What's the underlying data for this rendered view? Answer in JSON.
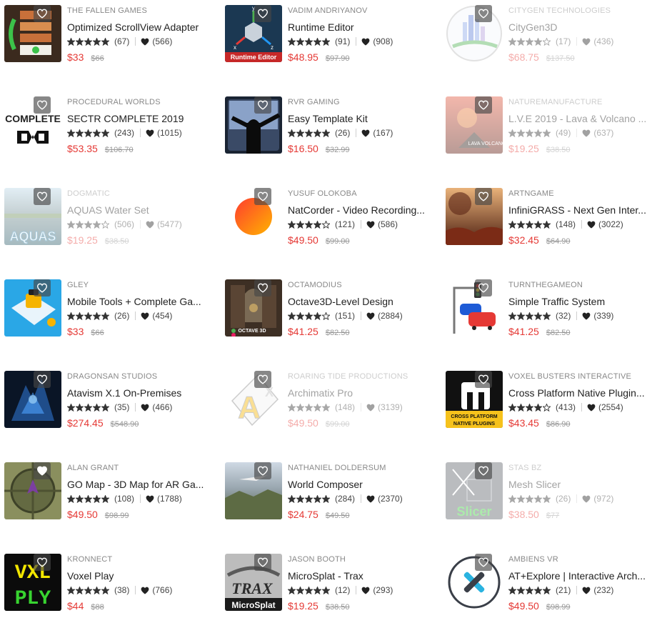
{
  "colors": {
    "price": "#e53935",
    "old_price": "#999999",
    "star": "#333333",
    "heart": "#222222"
  },
  "products": [
    {
      "publisher": "THE FALLEN GAMES",
      "title": "Optimized ScrollView Adapter",
      "rating": 5,
      "reviews": "(67)",
      "favorites": "(566)",
      "price": "$33",
      "old_price": "$66",
      "dimmed": false,
      "thumb": "scrollview-thumb",
      "fav_filled": false
    },
    {
      "publisher": "VADIM ANDRIYANOV",
      "title": "Runtime Editor",
      "rating": 5,
      "reviews": "(91)",
      "favorites": "(908)",
      "price": "$48.95",
      "old_price": "$97.90",
      "dimmed": false,
      "thumb": "runtime-editor-thumb",
      "thumb_text": "Runtime Editor",
      "axis_y": "y",
      "axis_x": "x",
      "axis_z": "z",
      "fav_filled": false
    },
    {
      "publisher": "CITYGEN TECHNOLOGIES",
      "title": "CityGen3D",
      "rating": 4,
      "reviews": "(17)",
      "favorites": "(436)",
      "price": "$68.75",
      "old_price": "$137.50",
      "dimmed": true,
      "thumb": "citygen-thumb",
      "fav_filled": false
    },
    {
      "publisher": "PROCEDURAL WORLDS",
      "title": "SECTR COMPLETE 2019",
      "rating": 5,
      "reviews": "(243)",
      "favorites": "(1015)",
      "price": "$53.35",
      "old_price": "$106.70",
      "dimmed": false,
      "thumb": "sectr-thumb",
      "thumb_text": "COMPLETE",
      "fav_filled": false
    },
    {
      "publisher": "RVR GAMING",
      "title": "Easy Template Kit",
      "rating": 5,
      "reviews": "(26)",
      "favorites": "(167)",
      "price": "$16.50",
      "old_price": "$32.99",
      "dimmed": false,
      "thumb": "template-kit-thumb",
      "fav_filled": false
    },
    {
      "publisher": "NATUREMANUFACTURE",
      "title": "L.V.E 2019 - Lava & Volcano ...",
      "rating": 5,
      "reviews": "(49)",
      "favorites": "(637)",
      "price": "$19.25",
      "old_price": "$38.50",
      "dimmed": true,
      "thumb": "lava-thumb",
      "thumb_text": "LAVA VOLCANO",
      "fav_filled": false
    },
    {
      "publisher": "DOGMATIC",
      "title": "AQUAS Water Set",
      "rating": 4,
      "reviews": "(506)",
      "favorites": "(5477)",
      "price": "$19.25",
      "old_price": "$38.50",
      "dimmed": true,
      "thumb": "aquas-thumb",
      "thumb_text": "AQUAS",
      "fav_filled": false
    },
    {
      "publisher": "YUSUF OLOKOBA",
      "title": "NatCorder - Video Recording...",
      "rating": 4,
      "reviews": "(121)",
      "favorites": "(586)",
      "price": "$49.50",
      "old_price": "$99.00",
      "dimmed": false,
      "thumb": "natcorder-thumb",
      "fav_filled": false
    },
    {
      "publisher": "ARTNGAME",
      "title": "InfiniGRASS - Next Gen Inter...",
      "rating": 5,
      "reviews": "(148)",
      "favorites": "(3022)",
      "price": "$32.45",
      "old_price": "$64.90",
      "dimmed": false,
      "thumb": "infinigrass-thumb",
      "fav_filled": false
    },
    {
      "publisher": "GLEY",
      "title": "Mobile Tools + Complete Ga...",
      "rating": 5,
      "reviews": "(26)",
      "favorites": "(454)",
      "price": "$33",
      "old_price": "$66",
      "dimmed": false,
      "thumb": "mobile-tools-thumb",
      "fav_filled": false
    },
    {
      "publisher": "OCTAMODIUS",
      "title": "Octave3D-Level Design",
      "rating": 4,
      "reviews": "(151)",
      "favorites": "(2884)",
      "price": "$41.25",
      "old_price": "$82.50",
      "dimmed": false,
      "thumb": "octave3d-thumb",
      "thumb_text": "OCTAVE 3D",
      "fav_filled": false
    },
    {
      "publisher": "TURNTHEGAMEON",
      "title": "Simple Traffic System",
      "rating": 5,
      "reviews": "(32)",
      "favorites": "(339)",
      "price": "$41.25",
      "old_price": "$82.50",
      "dimmed": false,
      "thumb": "traffic-thumb",
      "fav_filled": false
    },
    {
      "publisher": "DRAGONSAN STUDIOS",
      "title": "Atavism X.1 On-Premises",
      "rating": 5,
      "reviews": "(35)",
      "favorites": "(466)",
      "price": "$274.45",
      "old_price": "$548.90",
      "dimmed": false,
      "thumb": "atavism-thumb",
      "fav_filled": false
    },
    {
      "publisher": "ROARING TIDE PRODUCTIONS",
      "title": "Archimatix Pro",
      "rating": 5,
      "reviews": "(148)",
      "favorites": "(3139)",
      "price": "$49.50",
      "old_price": "$99.00",
      "dimmed": true,
      "thumb": "archimatix-thumb",
      "thumb_text": "A",
      "thumb_text2": "X",
      "fav_filled": false
    },
    {
      "publisher": "VOXEL BUSTERS INTERACTIVE",
      "title": "Cross Platform Native Plugin...",
      "rating": 4,
      "reviews": "(413)",
      "favorites": "(2554)",
      "price": "$43.45",
      "old_price": "$86.90",
      "dimmed": false,
      "thumb": "native-plugins-thumb",
      "thumb_text": "CROSS PLATFORM",
      "thumb_text2": "NATIVE PLUGINS",
      "fav_filled": false
    },
    {
      "publisher": "ALAN GRANT",
      "title": "GO Map - 3D Map for AR Ga...",
      "rating": 5,
      "reviews": "(108)",
      "favorites": "(1788)",
      "price": "$49.50",
      "old_price": "$98.99",
      "dimmed": false,
      "thumb": "gomap-thumb",
      "fav_filled": true
    },
    {
      "publisher": "NATHANIEL DOLDERSUM",
      "title": "World Composer",
      "rating": 5,
      "reviews": "(284)",
      "favorites": "(2370)",
      "price": "$24.75",
      "old_price": "$49.50",
      "dimmed": false,
      "thumb": "world-composer-thumb",
      "fav_filled": false
    },
    {
      "publisher": "STAS BZ",
      "title": "Mesh Slicer",
      "rating": 5,
      "reviews": "(26)",
      "favorites": "(972)",
      "price": "$38.50",
      "old_price": "$77",
      "dimmed": true,
      "thumb": "mesh-slicer-thumb",
      "thumb_text": "Slicer",
      "fav_filled": false
    },
    {
      "publisher": "KRONNECT",
      "title": "Voxel Play",
      "rating": 5,
      "reviews": "(38)",
      "favorites": "(766)",
      "price": "$44",
      "old_price": "$88",
      "dimmed": false,
      "thumb": "voxel-play-thumb",
      "thumb_text": "VXL",
      "thumb_text2": "PLY",
      "fav_filled": false
    },
    {
      "publisher": "JASON BOOTH",
      "title": "MicroSplat - Trax",
      "rating": 5,
      "reviews": "(12)",
      "favorites": "(293)",
      "price": "$19.25",
      "old_price": "$38.50",
      "dimmed": false,
      "thumb": "microsplat-thumb",
      "thumb_text": "TRAX",
      "thumb_text2": "MicroSplat",
      "fav_filled": false
    },
    {
      "publisher": "AMBIENS VR",
      "title": "AT+Explore | Interactive Arch...",
      "rating": 5,
      "reviews": "(21)",
      "favorites": "(232)",
      "price": "$49.50",
      "old_price": "$98.99",
      "dimmed": false,
      "thumb": "at-explore-thumb",
      "fav_filled": false
    }
  ]
}
